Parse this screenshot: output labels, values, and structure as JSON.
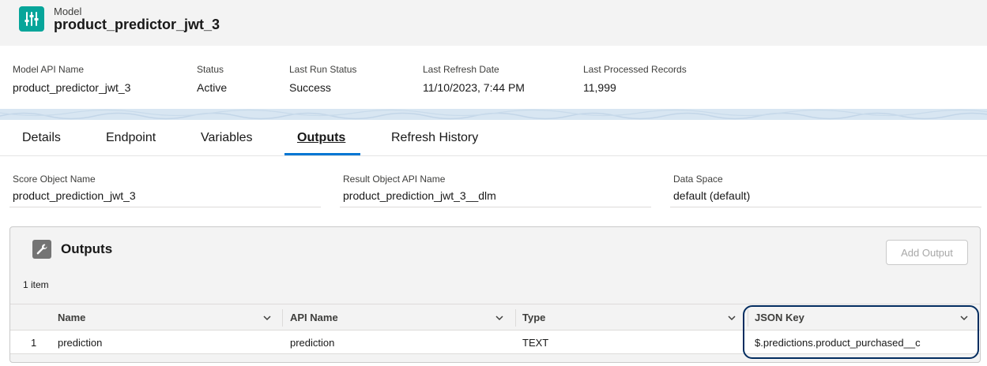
{
  "header": {
    "kicker": "Model",
    "title": "product_predictor_jwt_3",
    "icon": "sliders-icon"
  },
  "highlights": [
    {
      "label": "Model API Name",
      "value": "product_predictor_jwt_3"
    },
    {
      "label": "Status",
      "value": "Active"
    },
    {
      "label": "Last Run Status",
      "value": "Success"
    },
    {
      "label": "Last Refresh Date",
      "value": "11/10/2023, 7:44 PM"
    },
    {
      "label": "Last Processed Records",
      "value": "11,999"
    }
  ],
  "tabs": [
    {
      "label": "Details",
      "active": false
    },
    {
      "label": "Endpoint",
      "active": false
    },
    {
      "label": "Variables",
      "active": false
    },
    {
      "label": "Outputs",
      "active": true
    },
    {
      "label": "Refresh History",
      "active": false
    }
  ],
  "fields": [
    {
      "label": "Score Object Name",
      "value": "product_prediction_jwt_3"
    },
    {
      "label": "Result Object API Name",
      "value": "product_prediction_jwt_3__dlm"
    },
    {
      "label": "Data Space",
      "value": "default (default)"
    }
  ],
  "outputs": {
    "title": "Outputs",
    "icon": "wrench-icon",
    "add_button": "Add Output",
    "item_count": "1 item",
    "columns": [
      "Name",
      "API Name",
      "Type",
      "JSON Key"
    ],
    "rows": [
      {
        "index": "1",
        "name": "prediction",
        "api_name": "prediction",
        "type": "TEXT",
        "json_key": "$.predictions.product_purchased__c"
      }
    ]
  },
  "colors": {
    "brand_teal": "#06a59a",
    "active_tab": "#0176d3",
    "highlight_ring": "#032d60"
  }
}
